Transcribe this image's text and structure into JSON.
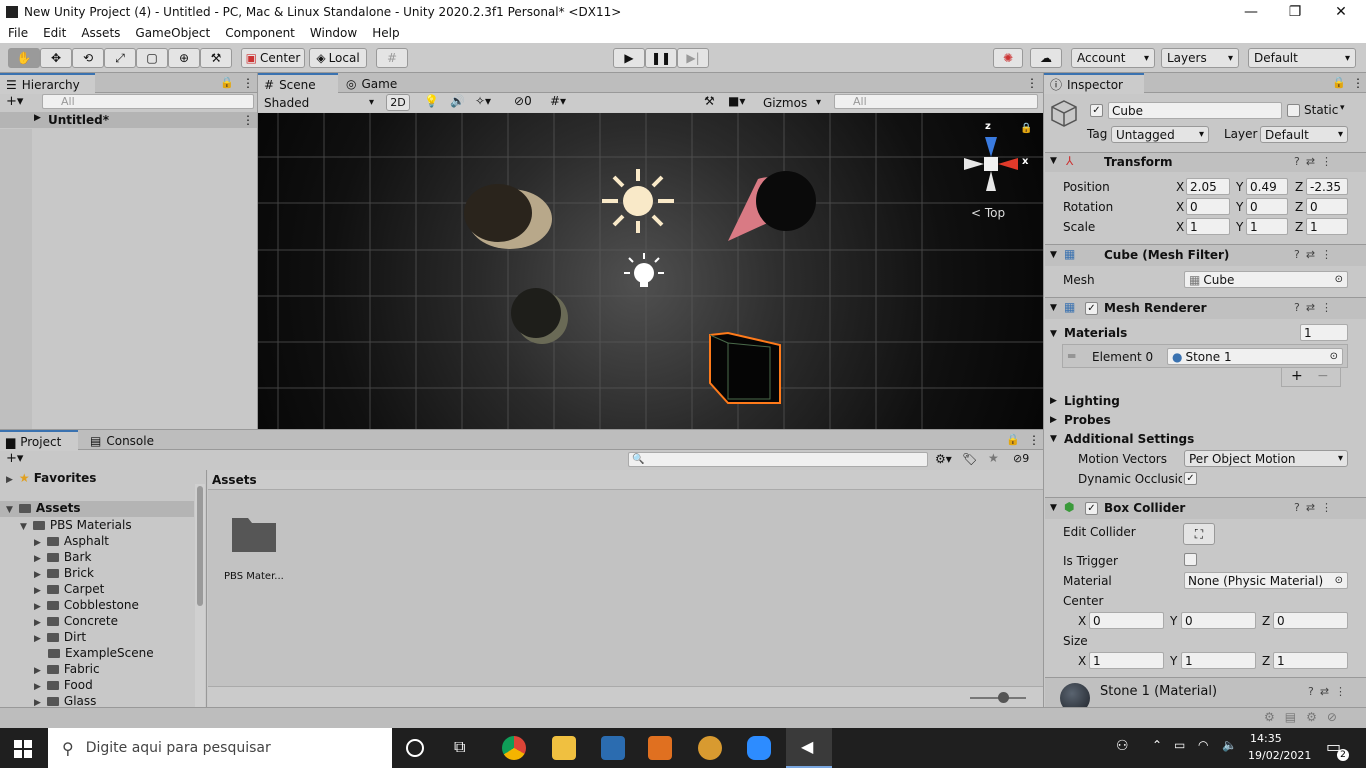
{
  "window": {
    "title": "New Unity Project (4) - Untitled - PC, Mac & Linux Standalone - Unity 2020.2.3f1 Personal* <DX11>",
    "minimize": "—",
    "restore": "❐",
    "close": "✕"
  },
  "menu": [
    "File",
    "Edit",
    "Assets",
    "GameObject",
    "Component",
    "Window",
    "Help"
  ],
  "toolbar": {
    "pivot": "Center",
    "space": "Local",
    "account": "Account",
    "layers": "Layers",
    "layout": "Default"
  },
  "hierarchy": {
    "tab": "Hierarchy",
    "search_placeholder": "All",
    "root": "Untitled*"
  },
  "scene": {
    "tabs": [
      "Scene",
      "Game"
    ],
    "draw_mode": "Shaded",
    "mode_2d": "2D",
    "hidden_count": "0",
    "gizmos": "Gizmos",
    "search_placeholder": "All",
    "view_label": "< Top",
    "axis_x": "x",
    "axis_z": "z"
  },
  "project": {
    "tabs": [
      "Project",
      "Console"
    ],
    "favorites": "Favorites",
    "assets_root": "Assets",
    "pbs": "PBS Materials",
    "folders": [
      "Asphalt",
      "Bark",
      "Brick",
      "Carpet",
      "Cobblestone",
      "Concrete",
      "Dirt",
      "ExampleScene",
      "Fabric",
      "Food",
      "Glass"
    ],
    "breadcrumb": "Assets",
    "grid_item": "PBS Mater...",
    "hidden_count": "9"
  },
  "inspector": {
    "tab": "Inspector",
    "object_name": "Cube",
    "static_label": "Static",
    "tag_label": "Tag",
    "tag_value": "Untagged",
    "layer_label": "Layer",
    "layer_value": "Default",
    "transform": {
      "title": "Transform",
      "position_label": "Position",
      "rotation_label": "Rotation",
      "scale_label": "Scale",
      "position": {
        "x": "2.05",
        "y": "0.49",
        "z": "-2.35"
      },
      "rotation": {
        "x": "0",
        "y": "0",
        "z": "0"
      },
      "scale": {
        "x": "1",
        "y": "1",
        "z": "1"
      }
    },
    "mesh_filter": {
      "title": "Cube (Mesh Filter)",
      "mesh_label": "Mesh",
      "mesh_value": "Cube"
    },
    "mesh_renderer": {
      "title": "Mesh Renderer",
      "materials_label": "Materials",
      "materials_count": "1",
      "element_label": "Element 0",
      "element_value": "Stone 1",
      "lighting": "Lighting",
      "probes": "Probes",
      "additional": "Additional Settings",
      "motion_label": "Motion Vectors",
      "motion_value": "Per Object Motion",
      "dynamic_label": "Dynamic Occlusioi"
    },
    "box_collider": {
      "title": "Box Collider",
      "edit_label": "Edit Collider",
      "trigger_label": "Is Trigger",
      "material_label": "Material",
      "material_value": "None (Physic Material)",
      "center_label": "Center",
      "size_label": "Size",
      "center": {
        "x": "0",
        "y": "0",
        "z": "0"
      },
      "size": {
        "x": "1",
        "y": "1",
        "z": "1"
      }
    },
    "material": "Stone 1 (Material)"
  },
  "axis_labels": {
    "x": "X",
    "y": "Y",
    "z": "Z"
  },
  "taskbar": {
    "search_placeholder": "Digite aqui para pesquisar",
    "time": "14:35",
    "date": "19/02/2021",
    "notifications": "2"
  }
}
